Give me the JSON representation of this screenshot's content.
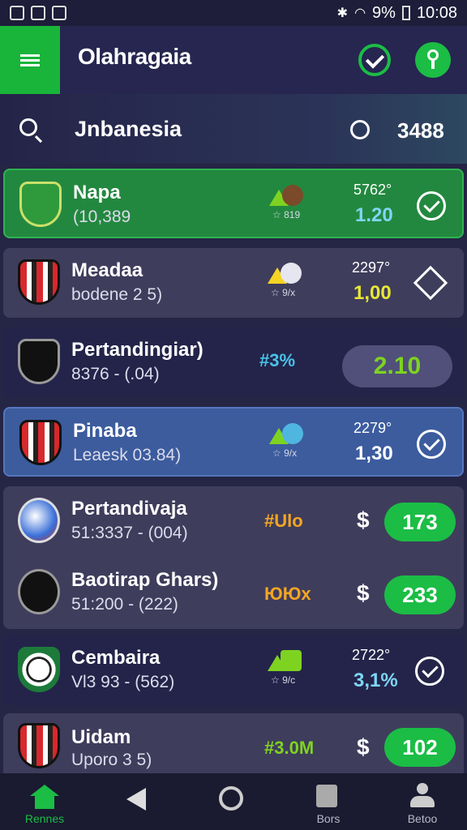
{
  "status_bar": {
    "battery": "9%",
    "time": "10:08"
  },
  "header": {
    "title": "Olahragaia"
  },
  "search": {
    "query": "Jnbanesia",
    "count": "3488"
  },
  "matches": [
    {
      "name": "Napa",
      "sub": "(10,389",
      "trend_pct": "☆ 819",
      "odds_small": "5762°",
      "odds_big": "1.20"
    },
    {
      "name": "Meadaa",
      "sub": "bodene 2 5)",
      "trend_pct": "☆ 9/x",
      "odds_small": "2297°",
      "odds_big": "1,00"
    },
    {
      "name": "Pertandingiar)",
      "sub": "8376 - (.04)",
      "pct": "#3%",
      "pill": "2.10"
    },
    {
      "name": "Pinaba",
      "sub": "Leaesk 03.84)",
      "trend_pct": "☆ 9/x",
      "odds_small": "2279°",
      "odds_big": "1,30"
    },
    {
      "name": "Pertandivaja",
      "sub": "51:3337 - (004)",
      "bet": "#Ulo",
      "dollar": "$",
      "pill": "173"
    },
    {
      "name": "Baotirap Ghars)",
      "sub": "51:200 - (222)",
      "bet": "ЮЮх",
      "dollar": "$",
      "pill": "233"
    },
    {
      "name": "Cembaira",
      "sub": "Vl3 93 - (562)",
      "trend_pct": "☆ 9/c",
      "odds_small": "2722°",
      "odds_big": "3,1%"
    },
    {
      "name": "Uidam",
      "sub": "Uporo 3 5)",
      "bet": "#3.0M",
      "dollar": "$",
      "pill": "102"
    }
  ],
  "nav": {
    "home": "Rennes",
    "back": "",
    "circle": "",
    "bors": "Bors",
    "betoo": "Betoo"
  },
  "colors": {
    "accent": "#1bbd45",
    "background": "#252545",
    "card_green": "#23883f",
    "card_blue": "#3c5c9e"
  }
}
